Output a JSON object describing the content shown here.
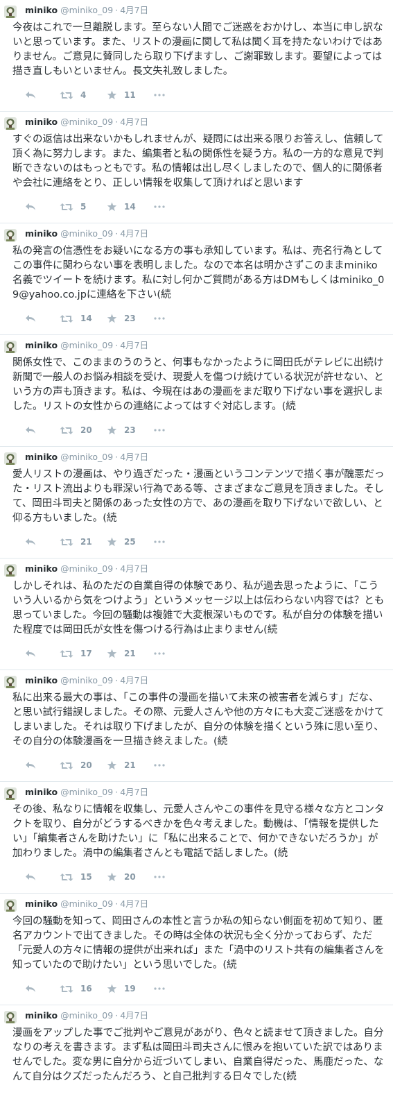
{
  "author": {
    "name": "miniko",
    "handle": "@miniko_09",
    "separator": "·"
  },
  "colors": {
    "text": "#292f33",
    "meta": "#8899a6",
    "icon": "#aab8c2",
    "divider": "#e1e8ed"
  },
  "icons": {
    "reply": "reply-icon",
    "retweet": "retweet-icon",
    "favorite": "star-icon",
    "more": "more-icon"
  },
  "tweets": [
    {
      "time": "4月7日",
      "text": "今夜はこれで一旦離脱します。至らない人間でご迷惑をおかけし、本当に申し訳ないと思っています。また、リストの漫画に関して私は聞く耳を持たないわけではありません。ご意見に賛同したら取り下げますし、ご謝罪致します。要望によっては描き直しもいといません。長文失礼致しました。",
      "retweets": "4",
      "favorites": "11"
    },
    {
      "time": "4月7日",
      "text": "すぐの返信は出来ないかもしれませんが、疑問には出来る限りお答えし、信頼して頂く為に努力します。また、編集者と私の関係性を疑う方。私の一方的な意見で判断できないのはもっともです。私の情報は出し尽くしましたので、個人的に関係者や会社に連絡をとり、正しい情報を収集して頂ければと思います",
      "retweets": "5",
      "favorites": "14"
    },
    {
      "time": "4月7日",
      "text": "私の発言の信憑性をお疑いになる方の事も承知しています。私は、売名行為としてこの事件に関わらない事を表明しました。なので本名は明かさずこのままminiko名義でツイートを続けます。私に対し何かご質問がある方はDMもしくはminiko_09@yahoo.co.jpに連絡を下さい(続",
      "retweets": "14",
      "favorites": "23"
    },
    {
      "time": "4月7日",
      "text": "関係女性で、このままのうのうと、何事もなかったように岡田氏がテレビに出続け新聞で一般人のお悩み相談を受け、現愛人を傷つけ続けている状況が許せない、という方の声も頂きます。私は、今現在はあの漫画をまだ取り下げない事を選択しました。リストの女性からの連絡によってはすぐ対応します。(続",
      "retweets": "20",
      "favorites": "23"
    },
    {
      "time": "4月7日",
      "text": "愛人リストの漫画は、やり過ぎだった・漫画というコンテンツで描く事が醜悪だった・リスト流出よりも罪深い行為である等、さまざまなご意見を頂きました。そして、岡田斗司夫と関係のあった女性の方で、あの漫画を取り下げないで欲しい、と仰る方もいました。(続",
      "retweets": "21",
      "favorites": "25"
    },
    {
      "time": "4月7日",
      "text": "しかしそれは、私のただの自業自得の体験であり、私が過去思ったように、「こういう人いるから気をつけよう」というメッセージ以上は伝わらない内容では？とも思っていました。今回の騒動は複雑で大変根深いものです。私が自分の体験を描いた程度では岡田氏が女性を傷つける行為は止まりません(続",
      "retweets": "17",
      "favorites": "21"
    },
    {
      "time": "4月7日",
      "text": "私に出来る最大の事は、「この事件の漫画を描いて未来の被害者を減らす」だな、と思い試行錯誤しました。その際、元愛人さんや他の方々にも大変ご迷惑をかけてしまいました。それは取り下げましたが、自分の体験を描くという殊に思い至り、その自分の体験漫画を一旦描き終えました。(続",
      "retweets": "20",
      "favorites": "21"
    },
    {
      "time": "4月7日",
      "text": "その後、私なりに情報を収集し、元愛人さんやこの事件を見守る様々な方とコンタクトを取り、自分がどうするべきかを色々考えました。動機は、「情報を提供したい」「編集者さんを助けたい」に「私に出来ることで、何かできないだろうか」が加わりました。渦中の編集者さんとも電話で話しました。(続",
      "retweets": "15",
      "favorites": "20"
    },
    {
      "time": "4月7日",
      "text": "今回の騒動を知って、岡田さんの本性と言うか私の知らない側面を初めて知り、匿名アカウントで出てきました。その時は全体の状況も全く分かっておらず、ただ「元愛人の方々に情報の提供が出来れば」また「渦中のリスト共有の編集者さんを知っていたので助けたい」という思いでした。(続",
      "retweets": "16",
      "favorites": "19"
    },
    {
      "time": "4月7日",
      "text": "漫画をアップした事でご批判やご意見があがり、色々と読ませて頂きました。自分なりの考えを書きます。まず私は岡田斗司夫さんに恨みを抱いていた訳ではありませんでした。変な男に自分から近づいてしまい、自業自得だった、馬鹿だった、なんて自分はクズだったんだろう、と自己批判する日々でした(続",
      "retweets": "",
      "favorites": ""
    }
  ]
}
